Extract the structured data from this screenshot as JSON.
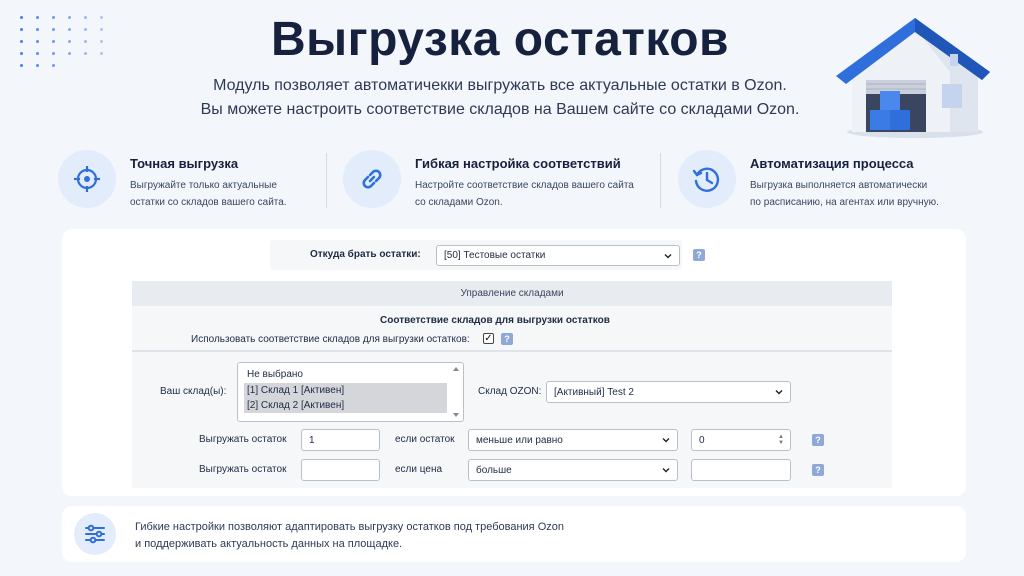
{
  "header": {
    "title": "Выгрузка остатков",
    "subtitle_line1": "Модуль позволяет автоматичекки выгружать все актуальные остатки в Ozon.",
    "subtitle_line2": "Вы можете настроить соответствие складов на Вашем сайте со складами Ozon."
  },
  "features": [
    {
      "icon": "target-icon",
      "title": "Точная выгрузка",
      "desc1": "Выгружайте только актуальные",
      "desc2": "остатки со складов вашего сайта."
    },
    {
      "icon": "link-icon",
      "title": "Гибкая настройка соответствий",
      "desc1": "Настройте соответствие складов вашего сайта",
      "desc2": "со складами Ozon."
    },
    {
      "icon": "clock-icon",
      "title": "Автоматизация процесса",
      "desc1": "Выгрузка выполняется автоматически",
      "desc2": "по расписанию, на агентах или вручную."
    }
  ],
  "form": {
    "source_label": "Откуда брать остатки:",
    "source_value": "[50] Тестовые остатки",
    "help_mark": "?",
    "section_title": "Управление складами",
    "mapping_title": "Соответствие складов  для выгрузки остатков",
    "use_mapping_label": "Использовать соответствие складов для выгрузки остатков:",
    "use_mapping_checked": true,
    "your_stores_label": "Ваш склад(ы):",
    "your_stores_options": [
      {
        "label": "Не выбрано",
        "selected": false
      },
      {
        "label": "[1] Склад 1 [Активен]",
        "selected": true
      },
      {
        "label": "[2] Склад 2 [Активен]",
        "selected": true
      }
    ],
    "ozon_store_label": "Склад OZON:",
    "ozon_store_value": "[Активный] Test 2",
    "rule1": {
      "label": "Выгружать остаток",
      "value": "1",
      "cond_label": "если остаток",
      "operator": "меньше или равно",
      "threshold": "0"
    },
    "rule2": {
      "label": "Выгружать остаток",
      "value": "",
      "cond_label": "если цена",
      "operator": "больше",
      "threshold": ""
    }
  },
  "footer": {
    "icon": "sliders-icon",
    "line1": "Гибкие настройки позволяют адаптировать выгрузку остатков под требования Ozon",
    "line2": "и поддерживать актуальность данных на площадке."
  },
  "colors": {
    "accent": "#2f6fdc",
    "icon_bg": "#e3ecfb",
    "page_bg": "#f3f6fb"
  }
}
